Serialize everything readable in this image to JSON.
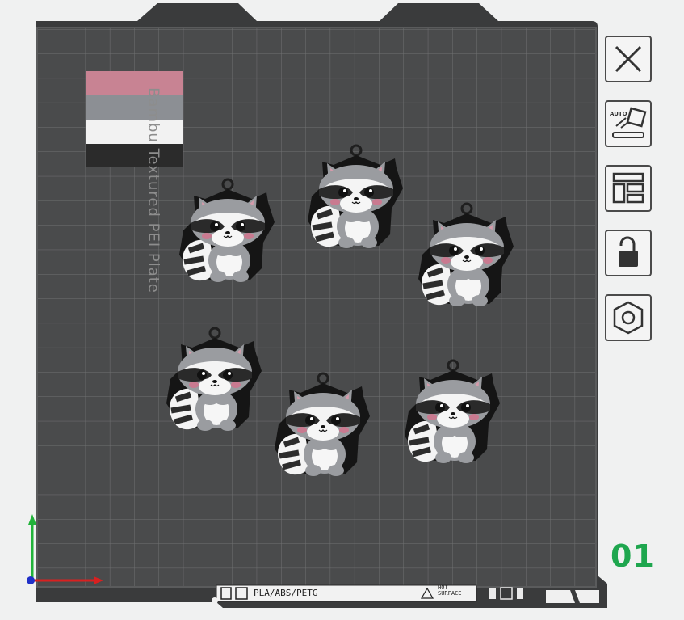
{
  "plate": {
    "label": "Bambu Textured PEI Plate",
    "number": "01",
    "bed_color": "#4a4b4c",
    "grid_color": "#6e6f70",
    "accent_number_color": "#1ea64e"
  },
  "filament_swatch": {
    "colors": [
      "#c88393",
      "#8c8f94",
      "#f2f2f2",
      "#2b2b2b"
    ]
  },
  "bed_info": {
    "material_text": "PLA/ABS/PETG",
    "hot_surface_line1": "HOT",
    "hot_surface_line2": "SURFACE"
  },
  "toolbar": {
    "buttons": [
      {
        "name": "close",
        "icon": "close-icon"
      },
      {
        "name": "auto-orient",
        "icon": "auto-orient-icon",
        "text": "AUTO"
      },
      {
        "name": "arrange",
        "icon": "arrange-icon"
      },
      {
        "name": "lock",
        "icon": "unlock-icon"
      },
      {
        "name": "settings",
        "icon": "hexagon-nut-icon"
      }
    ]
  },
  "models": {
    "count": 6,
    "name": "raccoon keychain"
  },
  "axes": {
    "x_color": "#d92020",
    "y_color": "#21b33a",
    "z_color": "#2030c8"
  }
}
